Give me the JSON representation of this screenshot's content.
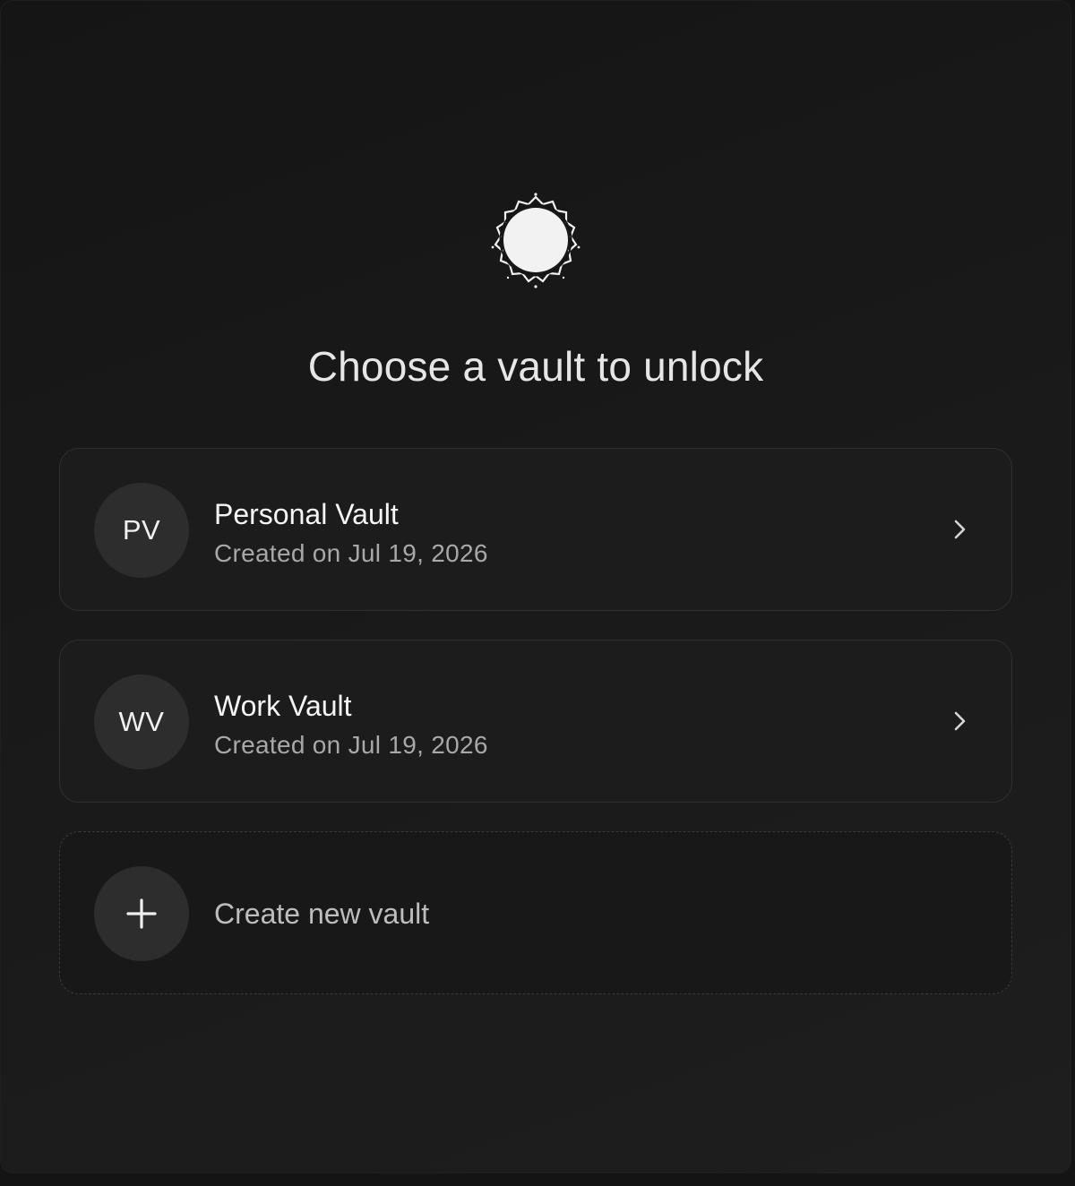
{
  "page": {
    "title": "Choose a vault to unlock",
    "logo_icon": "vault-seal-icon"
  },
  "vaults": [
    {
      "initials": "PV",
      "name": "Personal Vault",
      "created": "Created on Jul 19, 2026",
      "action_icon": "chevron-right-icon"
    },
    {
      "initials": "WV",
      "name": "Work Vault",
      "created": "Created on Jul 19, 2026",
      "action_icon": "chevron-right-icon"
    }
  ],
  "create": {
    "label": "Create new vault",
    "icon": "plus-icon"
  },
  "colors": {
    "background": "#141414",
    "card": "#1c1c1c",
    "card_border": "#303030",
    "avatar": "#2d2d2d",
    "text_primary": "#f5f5f5",
    "text_secondary": "#a8a8a8"
  }
}
